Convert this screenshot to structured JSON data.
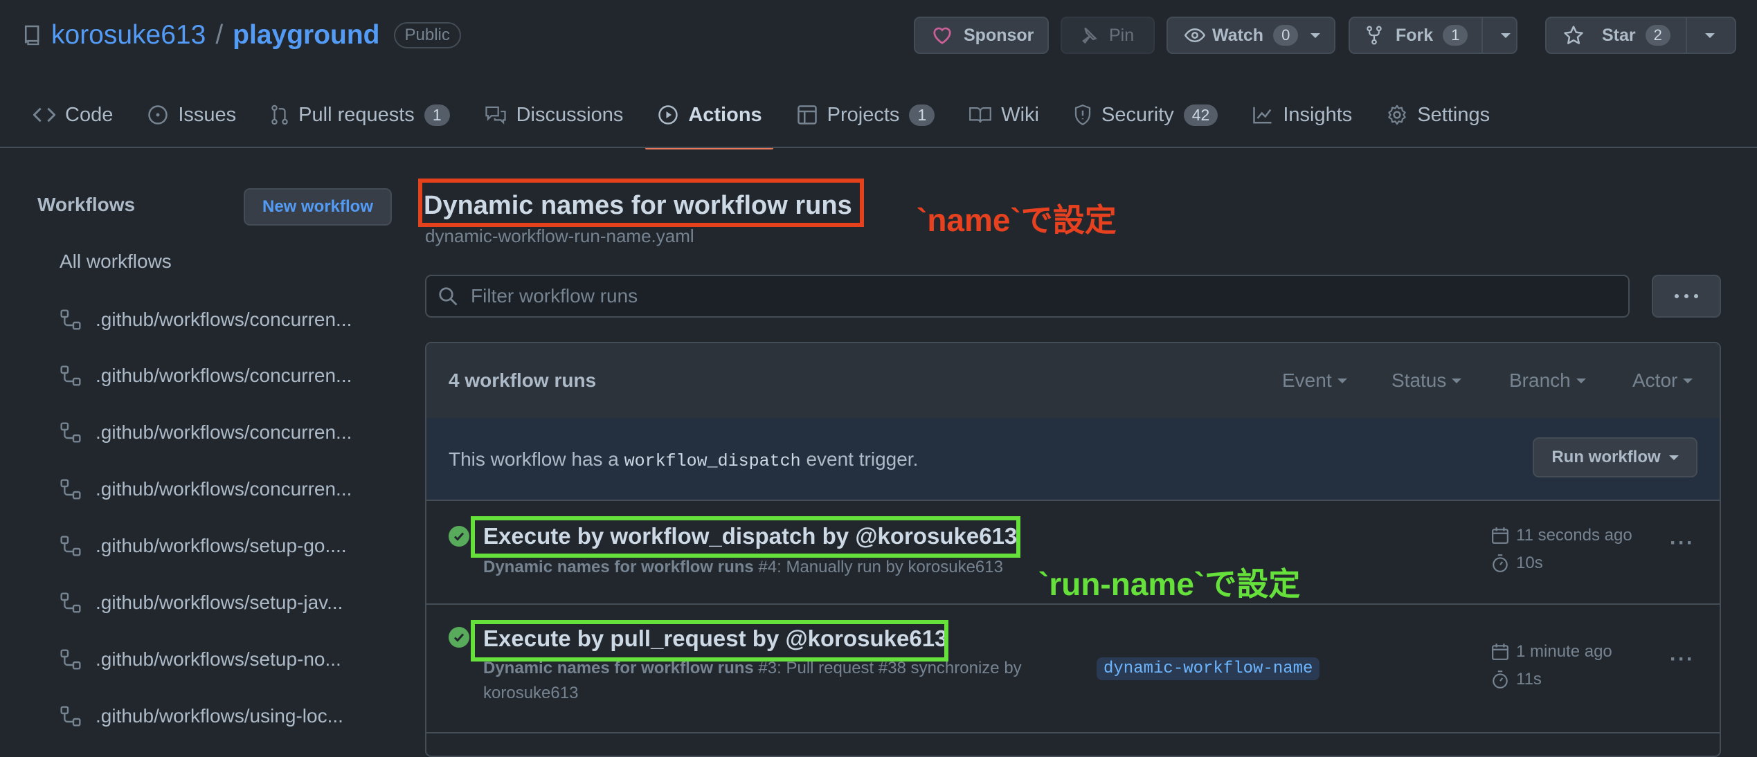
{
  "repo": {
    "owner": "korosuke613",
    "slash": "/",
    "name": "playground",
    "visibility": "Public"
  },
  "actions_bar": {
    "sponsor": "Sponsor",
    "pin": "Pin",
    "watch": {
      "label": "Watch",
      "count": "0"
    },
    "fork": {
      "label": "Fork",
      "count": "1"
    },
    "star": {
      "label": "Star",
      "count": "2"
    }
  },
  "tabs": [
    {
      "label": "Code",
      "icon": "code-icon"
    },
    {
      "label": "Issues",
      "icon": "issue-icon"
    },
    {
      "label": "Pull requests",
      "icon": "pull-request-icon",
      "count": "1"
    },
    {
      "label": "Discussions",
      "icon": "discussion-icon"
    },
    {
      "label": "Actions",
      "icon": "play-icon",
      "active": true
    },
    {
      "label": "Projects",
      "icon": "table-icon",
      "count": "1"
    },
    {
      "label": "Wiki",
      "icon": "book-icon"
    },
    {
      "label": "Security",
      "icon": "shield-icon",
      "count": "42"
    },
    {
      "label": "Insights",
      "icon": "graph-icon"
    },
    {
      "label": "Settings",
      "icon": "gear-icon"
    }
  ],
  "sidebar": {
    "title": "Workflows",
    "new_workflow": "New workflow",
    "all": "All workflows",
    "items": [
      ".github/workflows/concurren...",
      ".github/workflows/concurren...",
      ".github/workflows/concurren...",
      ".github/workflows/concurren...",
      ".github/workflows/setup-go....",
      ".github/workflows/setup-jav...",
      ".github/workflows/setup-no...",
      ".github/workflows/using-loc..."
    ]
  },
  "main": {
    "title": "Dynamic names for workflow runs",
    "file": "dynamic-workflow-run-name.yaml",
    "filter_placeholder": "Filter workflow runs",
    "runs_count": "4 workflow runs",
    "filters": [
      "Event",
      "Status",
      "Branch",
      "Actor"
    ],
    "dispatch": {
      "before": "This workflow has a ",
      "code": "workflow_dispatch",
      "after": " event trigger."
    },
    "run_workflow": "Run workflow",
    "runs": [
      {
        "title": "Execute by workflow_dispatch by @korosuke613",
        "workflow": "Dynamic names for workflow runs",
        "detail": " #4: Manually run by korosuke613",
        "time": "11 seconds ago",
        "duration": "10s",
        "status": "success"
      },
      {
        "title": "Execute by pull_request by @korosuke613",
        "workflow": "Dynamic names for workflow runs",
        "detail": " #3: Pull request #38 synchronize by korosuke613",
        "branch": "dynamic-workflow-name",
        "time": "1 minute ago",
        "duration": "11s",
        "status": "success"
      }
    ]
  },
  "annotations": {
    "name_note": "`name`で設定",
    "run_name_note": "`run-name`で設定",
    "red": "#e4411c",
    "green": "#66e13b"
  }
}
